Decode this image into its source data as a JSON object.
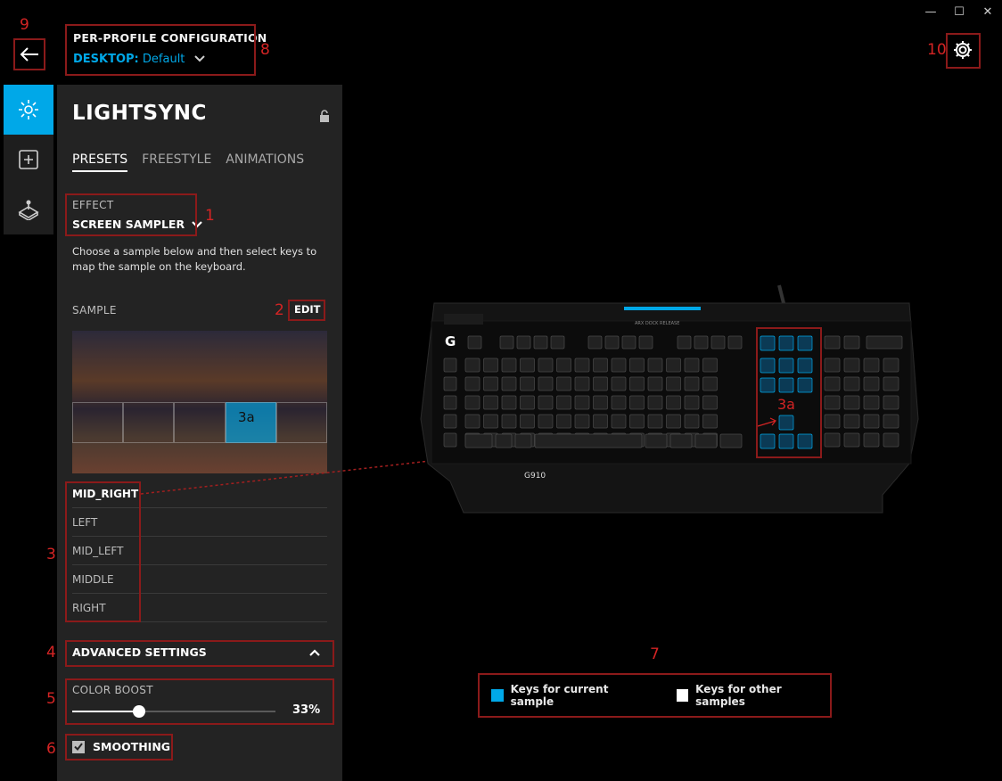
{
  "window": {
    "minimize": "—",
    "maximize": "☐",
    "close": "✕"
  },
  "header": {
    "profile_title": "PER-PROFILE CONFIGURATION",
    "profile_label": "DESKTOP:",
    "profile_value": "Default"
  },
  "panel": {
    "title": "LIGHTSYNC",
    "tabs": [
      {
        "label": "PRESETS"
      },
      {
        "label": "FREESTYLE"
      },
      {
        "label": "ANIMATIONS"
      }
    ],
    "effect_label": "EFFECT",
    "effect_value": "SCREEN SAMPLER",
    "description": "Choose a sample below and then select keys to map the sample on the keyboard.",
    "sample_label": "SAMPLE",
    "edit_label": "EDIT",
    "sample_region_label": "3a",
    "samples": [
      {
        "label": "MID_RIGHT"
      },
      {
        "label": "LEFT"
      },
      {
        "label": "MID_LEFT"
      },
      {
        "label": "MIDDLE"
      },
      {
        "label": "RIGHT"
      }
    ],
    "advanced_label": "ADVANCED SETTINGS",
    "color_boost_label": "COLOR BOOST",
    "color_boost_value": "33%",
    "color_boost_fraction": 0.33,
    "smoothing_label": "SMOOTHING",
    "smoothing_checked": true
  },
  "keyboard": {
    "model": "G910",
    "region_label": "3a",
    "release_label": "ARX DOCK RELEASE"
  },
  "legend": {
    "current_label": "Keys for current sample",
    "current_color": "#00a8e8",
    "other_label": "Keys for other samples",
    "other_color": "#ffffff"
  },
  "annotations": [
    "1",
    "2",
    "3",
    "3a",
    "4",
    "5",
    "6",
    "7",
    "8",
    "9",
    "10"
  ],
  "colors": {
    "accent": "#00a8e8",
    "annotation": "#d42424"
  }
}
